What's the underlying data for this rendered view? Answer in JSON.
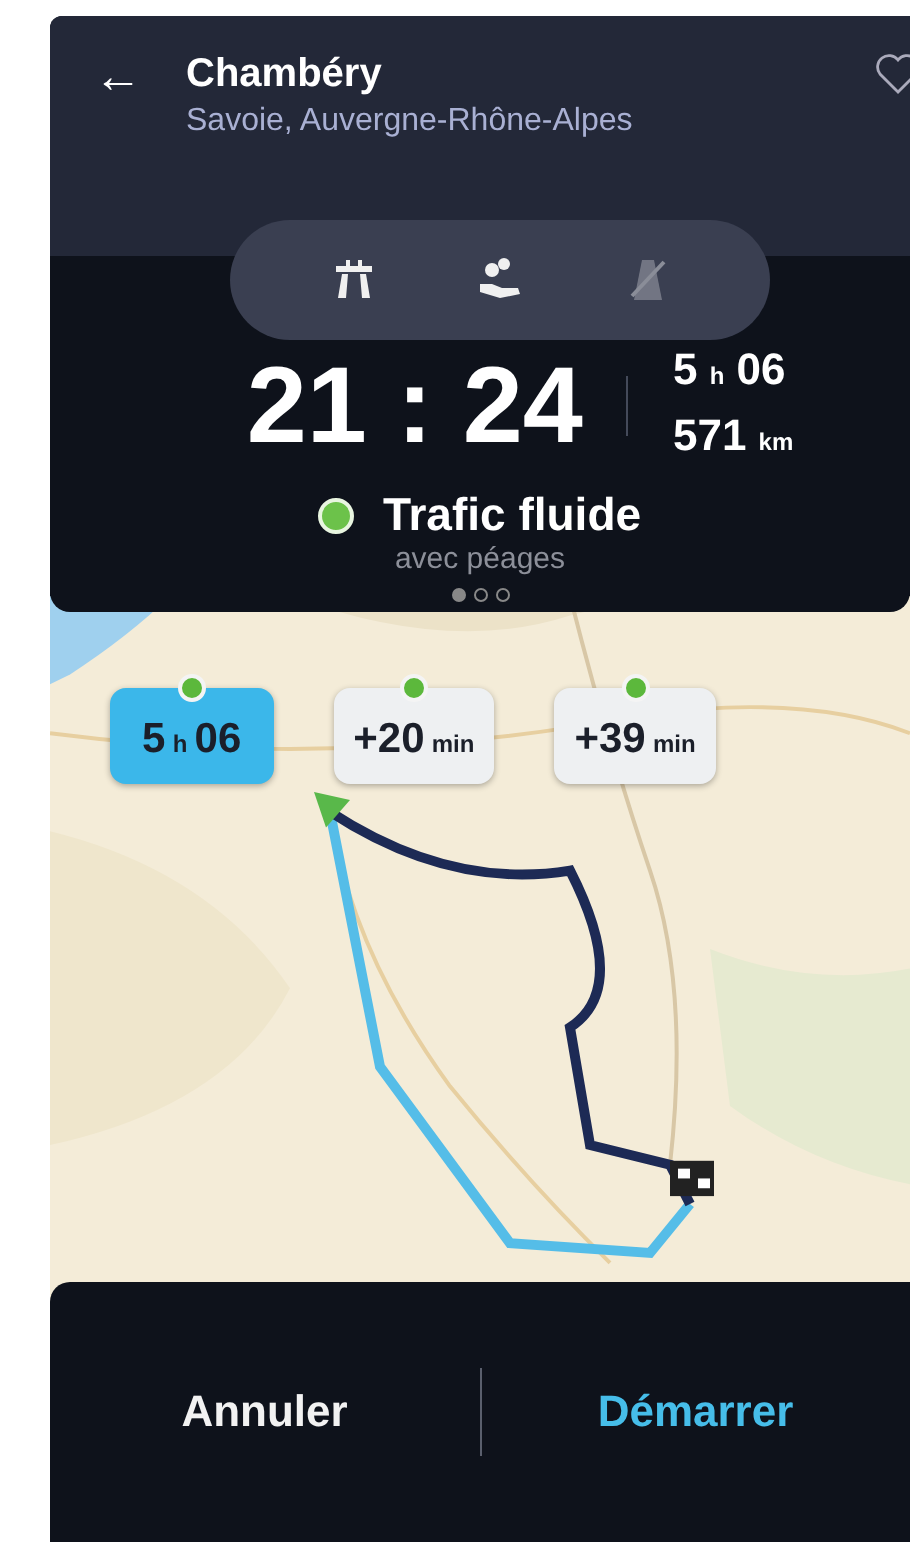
{
  "header": {
    "back": "←",
    "title": "Chambéry",
    "subtitle": "Savoie, Auvergne-Rhône-Alpes",
    "favorite": false
  },
  "route_options_toggles": [
    {
      "kind": "highway",
      "on": true
    },
    {
      "kind": "toll",
      "on": true
    },
    {
      "kind": "unpaved",
      "on": false
    }
  ],
  "summary": {
    "arrival": "21 : 24",
    "duration": {
      "hours": "5",
      "unit": "h",
      "minutes": "06"
    },
    "distance": {
      "value": "571",
      "unit": "km"
    },
    "traffic": "Trafic fluide",
    "note": "avec péages"
  },
  "pages": [
    {
      "selected": true
    },
    {
      "selected": false
    },
    {
      "selected": false
    }
  ],
  "routes": [
    {
      "value": "5",
      "unit": "h",
      "extra": "06",
      "selected": true
    },
    {
      "value": "+20",
      "unit": "min",
      "selected": false
    },
    {
      "value": "+39",
      "unit": "min",
      "selected": false
    }
  ],
  "actions": [
    {
      "label": "Annuler",
      "primary": false
    },
    {
      "label": "Démarrer",
      "primary": true
    }
  ]
}
